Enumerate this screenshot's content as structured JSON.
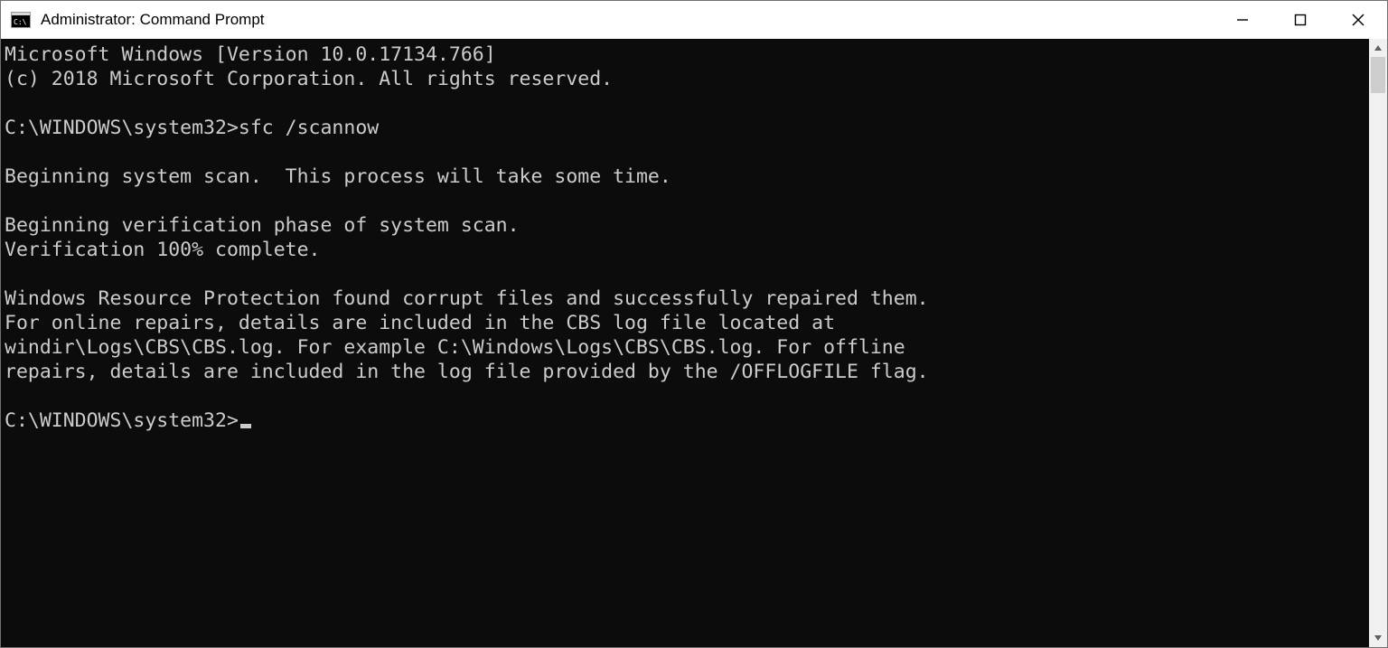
{
  "window": {
    "title": "Administrator: Command Prompt"
  },
  "console": {
    "lines": [
      "Microsoft Windows [Version 10.0.17134.766]",
      "(c) 2018 Microsoft Corporation. All rights reserved.",
      "",
      "C:\\WINDOWS\\system32>sfc /scannow",
      "",
      "Beginning system scan.  This process will take some time.",
      "",
      "Beginning verification phase of system scan.",
      "Verification 100% complete.",
      "",
      "Windows Resource Protection found corrupt files and successfully repaired them.",
      "For online repairs, details are included in the CBS log file located at",
      "windir\\Logs\\CBS\\CBS.log. For example C:\\Windows\\Logs\\CBS\\CBS.log. For offline",
      "repairs, details are included in the log file provided by the /OFFLOGFILE flag.",
      ""
    ],
    "prompt": "C:\\WINDOWS\\system32>"
  }
}
